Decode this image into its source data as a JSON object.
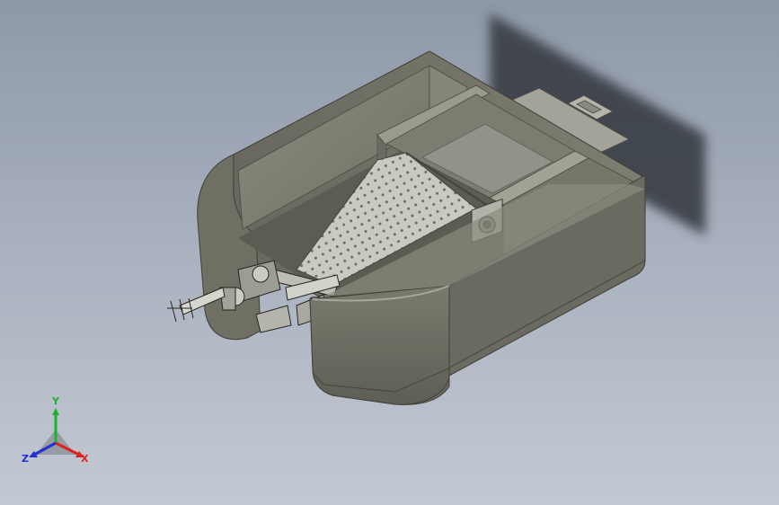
{
  "viewport": {
    "background_top": "#8e98a8",
    "background_bottom": "#c3c9d3"
  },
  "model": {
    "hull_color": "#7b7b6f",
    "hull_dark": "#5f5f55",
    "hull_light": "#9a9a8c",
    "shadow_color": "#3e4248",
    "mesh_color": "#cfcfc7",
    "mesh_hole_color": "#6e6e66"
  },
  "triad": {
    "x_label": "X",
    "y_label": "Y",
    "z_label": "Z",
    "x_color": "#e02020",
    "y_color": "#20b030",
    "z_color": "#2030d0"
  }
}
